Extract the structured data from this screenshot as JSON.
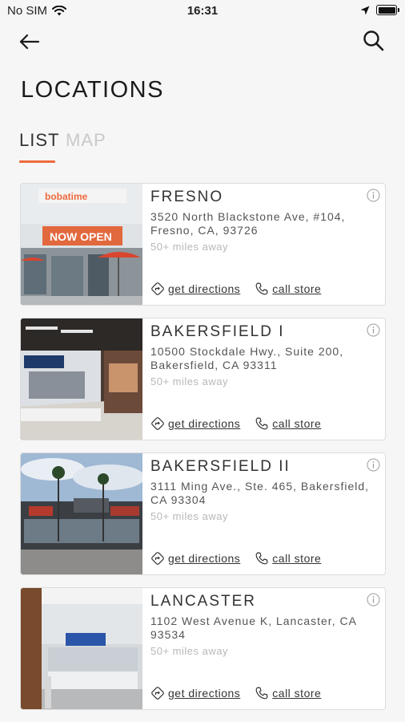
{
  "status_bar": {
    "carrier": "No SIM",
    "time": "16:31"
  },
  "header": {
    "title": "LOCATIONS"
  },
  "tabs": [
    {
      "label": "LIST",
      "active": true
    },
    {
      "label": "MAP",
      "active": false
    }
  ],
  "colors": {
    "accent": "#ef6a3d",
    "inactive_tab": "#c9c9c9"
  },
  "locations": [
    {
      "name": "FRESNO",
      "address": "3520 North Blackstone Ave, #104, Fresno, CA, 93726",
      "distance": "50+ miles away",
      "directions_label": "get directions",
      "call_label": "call store"
    },
    {
      "name": "BAKERSFIELD I",
      "address": "10500 Stockdale Hwy., Suite 200, Bakersfield, CA 93311",
      "distance": "50+ miles away",
      "directions_label": "get directions",
      "call_label": "call store"
    },
    {
      "name": "BAKERSFIELD II",
      "address": "3111 Ming Ave., Ste. 465, Bakersfield, CA 93304",
      "distance": "50+ miles away",
      "directions_label": "get directions",
      "call_label": "call store"
    },
    {
      "name": "LANCASTER",
      "address": "1102 West Avenue K, Lancaster, CA 93534",
      "distance": "50+ miles away",
      "directions_label": "get directions",
      "call_label": "call store"
    }
  ],
  "photos": [
    {
      "sign_text": "bobatime",
      "banner_text": "NOW OPEN"
    }
  ]
}
